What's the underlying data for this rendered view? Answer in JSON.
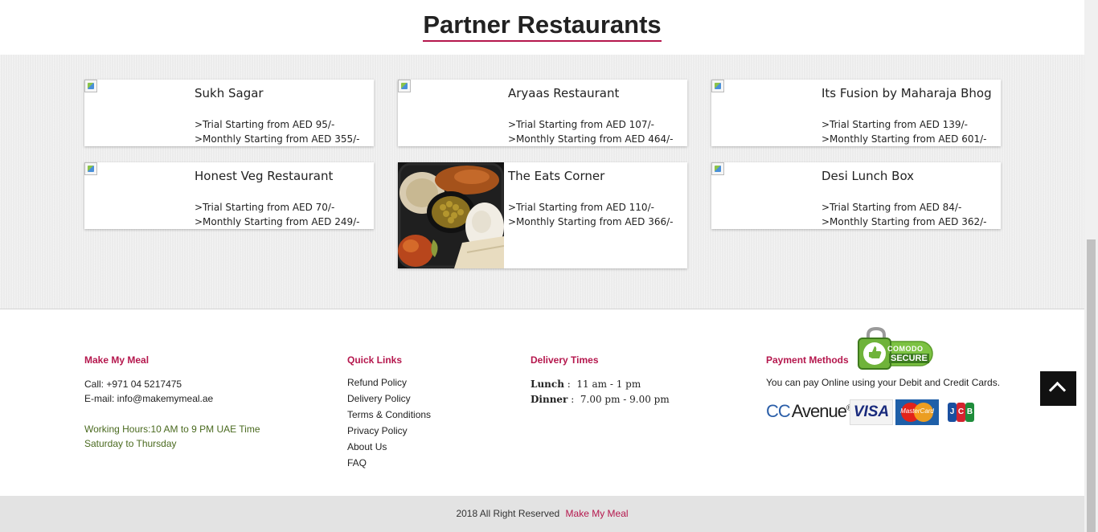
{
  "section_title": "Partner Restaurants",
  "restaurants": [
    {
      "name": "Sukh Sagar",
      "trial": ">Trial Starting from AED 95/-",
      "monthly": ">Monthly Starting from AED 355/-"
    },
    {
      "name": "Aryaas Restaurant",
      "trial": ">Trial Starting from AED 107/-",
      "monthly": ">Monthly Starting from AED 464/-"
    },
    {
      "name": "Its Fusion by Maharaja Bhog",
      "trial": ">Trial Starting from AED 139/-",
      "monthly": ">Monthly Starting from AED 601/-"
    },
    {
      "name": "Honest Veg Restaurant",
      "trial": ">Trial Starting from AED 70/-",
      "monthly": ">Monthly Starting from AED 249/-"
    },
    {
      "name": "The Eats Corner",
      "trial": ">Trial Starting from AED 110/-",
      "monthly": ">Monthly Starting from AED 366/-"
    },
    {
      "name": "Desi Lunch Box",
      "trial": ">Trial Starting from AED 84/-",
      "monthly": ">Monthly Starting from AED 362/-"
    }
  ],
  "footer": {
    "about": {
      "heading": "Make My Meal",
      "call": "Call: +971 04 5217475",
      "email": "E-mail: info@makemymeal.ae",
      "hours": "Working Hours:10 AM to 9 PM UAE Time",
      "days": "Saturday to Thursday"
    },
    "quick_links": {
      "heading": "Quick Links",
      "links": [
        "Refund Policy",
        "Delivery Policy",
        "Terms & Conditions",
        "Privacy Policy",
        "About Us",
        "FAQ"
      ]
    },
    "delivery": {
      "heading": "Delivery Times",
      "lunch_label": "Lunch",
      "lunch_time": "11 am - 1 pm",
      "dinner_label": "Dinner",
      "dinner_time": "7.00 pm - 9.00 pm"
    },
    "payment": {
      "heading": "Payment Methods",
      "text": "You can pay Online using your Debit and Credit Cards.",
      "logos": [
        "CC Avenue",
        "VISA",
        "MasterCard",
        "JCB"
      ],
      "badge": {
        "line1": "COMODO",
        "line2": "SECURE"
      }
    }
  },
  "copyright": {
    "text": "2018 All Right Reserved",
    "brand": "Make My Meal"
  },
  "colors": {
    "accent": "#b5174d",
    "band": "#ececec",
    "footer_bar": "#e3e3e3",
    "green_text": "#4a6a1f"
  },
  "icons": {
    "back_to_top": "chevron-up-icon",
    "broken_image": "broken-image-icon"
  }
}
